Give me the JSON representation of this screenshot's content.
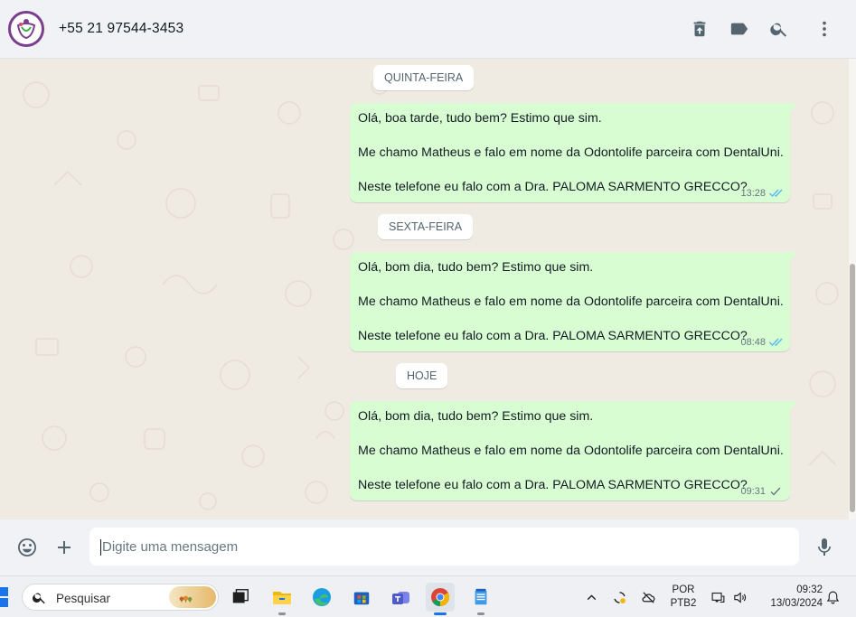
{
  "header": {
    "contact_name": "+55 21 97544-3453",
    "icons": [
      "delete-icon",
      "label-icon",
      "search-icon",
      "menu-icon"
    ]
  },
  "chat": {
    "days": [
      {
        "chip": "QUINTA-FEIRA",
        "message": {
          "lines": [
            "Olá, boa tarde, tudo bem? Estimo que sim.",
            "Me chamo Matheus e falo em nome da Odontolife parceira com DentalUni.",
            "Neste telefone eu falo com a Dra. PALOMA SARMENTO GRECCO?"
          ],
          "time": "13:28",
          "status": "read"
        }
      },
      {
        "chip": "SEXTA-FEIRA",
        "message": {
          "lines": [
            "Olá, bom dia, tudo bem? Estimo que sim.",
            "Me chamo Matheus e falo em nome da Odontolife parceira com DentalUni.",
            "Neste telefone eu falo com a Dra. PALOMA SARMENTO GRECCO?"
          ],
          "time": "08:48",
          "status": "read"
        }
      },
      {
        "chip": "HOJE",
        "message": {
          "lines": [
            "Olá, bom dia, tudo bem? Estimo que sim.",
            "Me chamo Matheus e falo em nome da Odontolife parceira com DentalUni.",
            "Neste telefone eu falo com a Dra. PALOMA SARMENTO GRECCO?"
          ],
          "time": "09:31",
          "status": "sent"
        }
      }
    ]
  },
  "composer": {
    "placeholder": "Digite uma mensagem"
  },
  "taskbar": {
    "search_label": "Pesquisar",
    "language": "POR",
    "keyboard": "PTB2",
    "time": "09:32",
    "date": "13/03/2024"
  },
  "colors": {
    "bubble_out": "#d9fdd3",
    "chat_bg": "#efeae2",
    "header_bg": "#f0f2f5",
    "read_tick": "#53bdeb",
    "sent_tick": "#667781"
  }
}
